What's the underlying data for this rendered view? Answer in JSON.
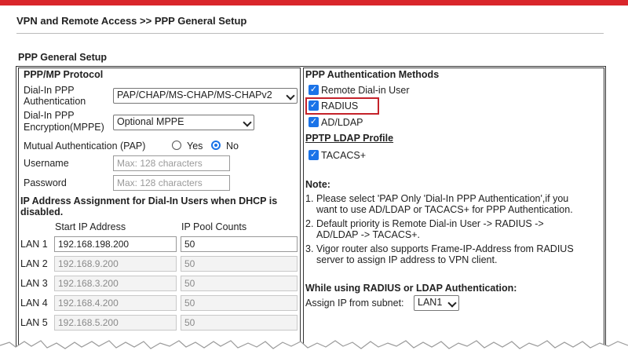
{
  "breadcrumb": "VPN and Remote Access >> PPP General Setup",
  "section_title": "PPP General Setup",
  "left": {
    "heading": "PPP/MP Protocol",
    "auth_label_1": "Dial-In PPP",
    "auth_label_2": "Authentication",
    "auth_value": "PAP/CHAP/MS-CHAP/MS-CHAPv2",
    "enc_label_1": "Dial-In PPP",
    "enc_label_2": "Encryption(MPPE)",
    "enc_value": "Optional MPPE",
    "mutual_label": "Mutual Authentication (PAP)",
    "yes_label": "Yes",
    "no_label": "No",
    "username_label": "Username",
    "username_placeholder": "Max: 128 characters",
    "password_label": "Password",
    "password_placeholder": "Max: 128 characters",
    "ip_heading_1": "IP Address Assignment for Dial-In Users when DHCP is",
    "ip_heading_2": "disabled.",
    "col_start_ip": "Start IP Address",
    "col_pool": "IP Pool Counts",
    "lans": [
      {
        "label": "LAN 1",
        "ip": "192.168.198.200",
        "count": "50"
      },
      {
        "label": "LAN 2",
        "ip": "192.168.9.200",
        "count": "50"
      },
      {
        "label": "LAN 3",
        "ip": "192.168.3.200",
        "count": "50"
      },
      {
        "label": "LAN 4",
        "ip": "192.168.4.200",
        "count": "50"
      },
      {
        "label": "LAN 5",
        "ip": "192.168.5.200",
        "count": "50"
      }
    ]
  },
  "right": {
    "heading": "PPP Authentication Methods",
    "remote_dialin": "Remote Dial-in User",
    "radius": "RADIUS",
    "adldap": "AD/LDAP",
    "pptp_ldap_profile": "PPTP LDAP Profile",
    "tacacs": "TACACS+",
    "note_title": "Note:",
    "notes": [
      {
        "num": "1.",
        "line1": "Please select 'PAP Only 'Dial-In PPP Authentication',if you",
        "line2": "want to use AD/LDAP or TACACS+ for PPP Authentication."
      },
      {
        "num": "2.",
        "line1": "Default priority is Remote Dial-in User -> RADIUS ->",
        "line2": "AD/LDAP -> TACACS+."
      },
      {
        "num": "3.",
        "line1": "Vigor router also supports Frame-IP-Address from RADIUS",
        "line2": "server to assign IP address to VPN client."
      }
    ],
    "radius_ldap_heading": "While using RADIUS or LDAP Authentication:",
    "assign_label": "Assign IP from subnet:",
    "assign_value": "LAN1"
  },
  "colors": {
    "accent": "#1a73e8",
    "brand": "#d9262b",
    "highlight": "#c4222a"
  }
}
